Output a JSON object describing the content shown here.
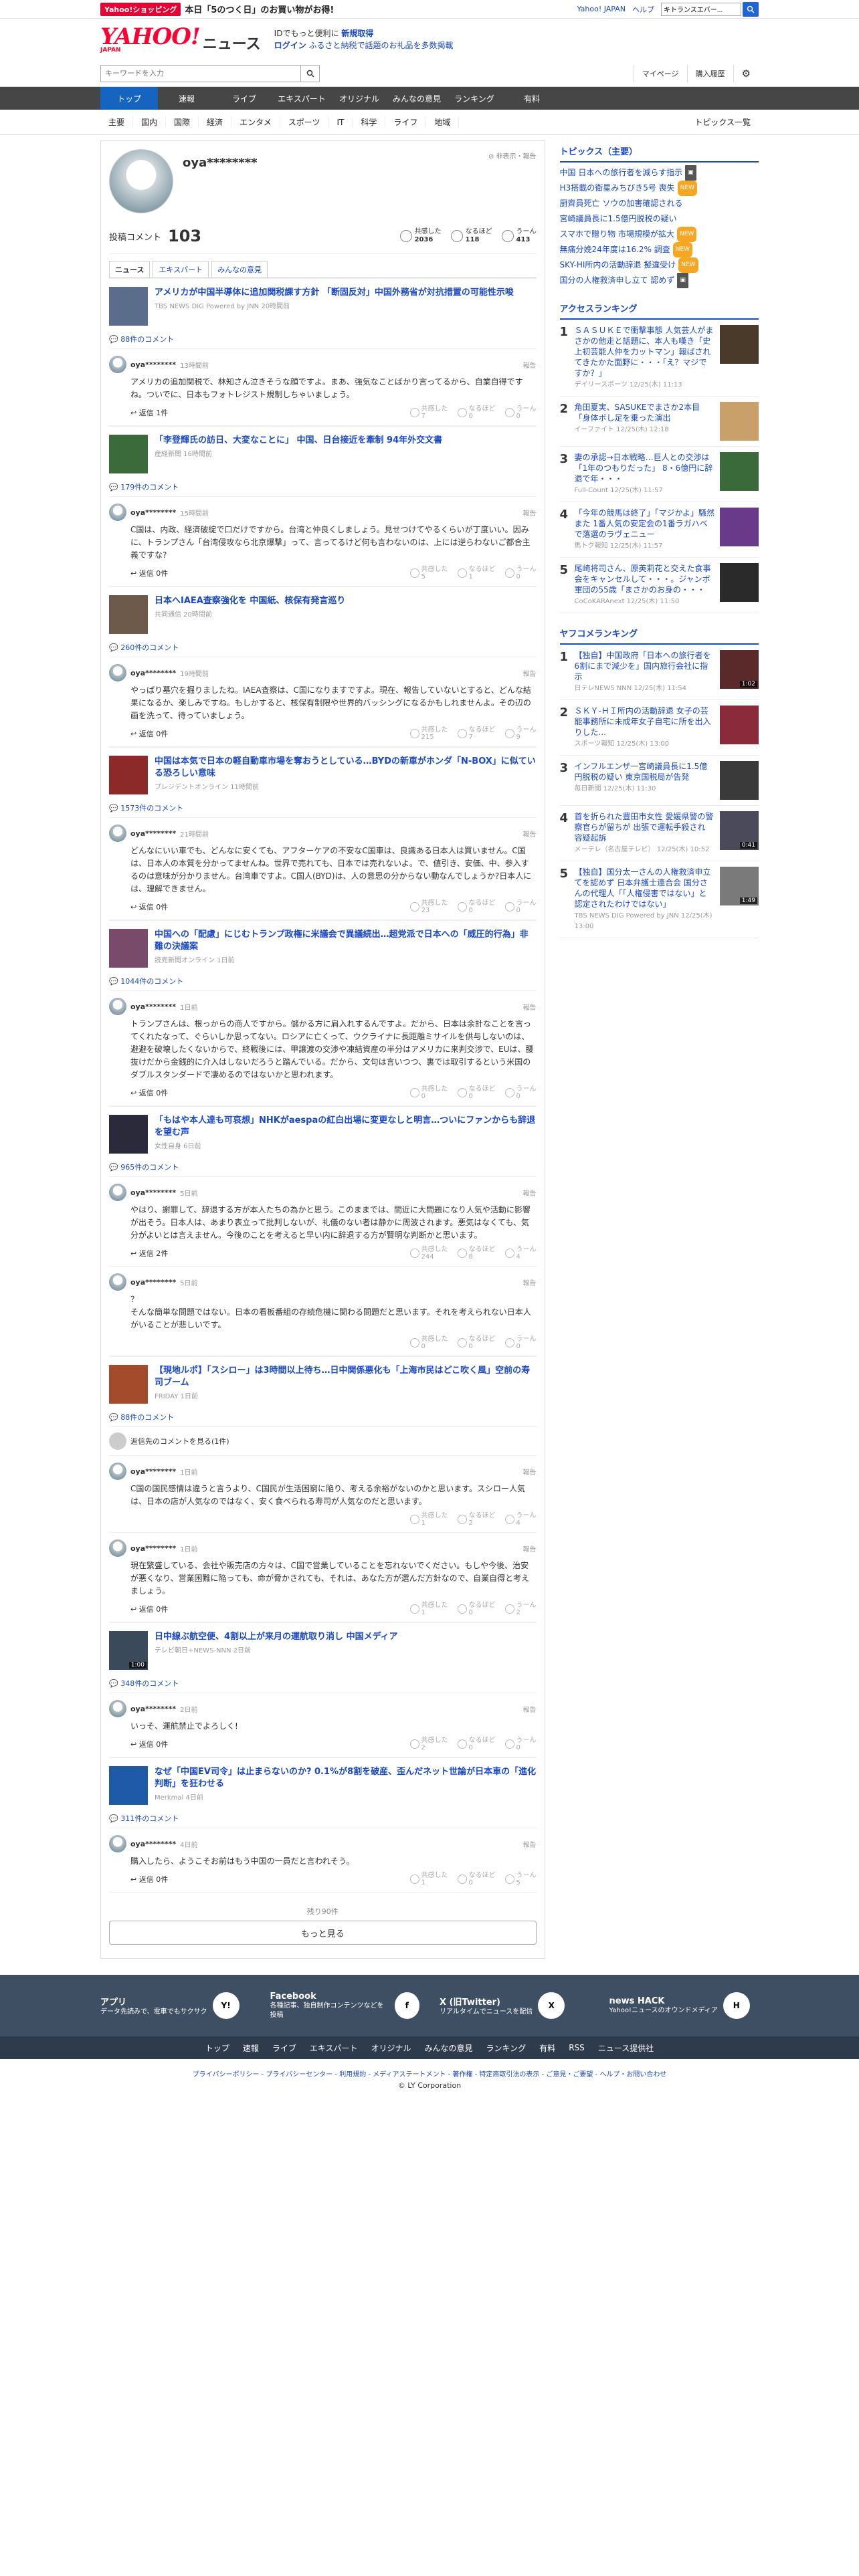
{
  "promo": {
    "tag": "Yahoo!ショッピング",
    "text": "本日「5のつく日」のお買い物がお得!",
    "links": [
      "Yahoo! JAPAN",
      "ヘルプ"
    ],
    "search_placeholder": "ウェブ検索",
    "search_value": "キトランスエバー..."
  },
  "header": {
    "logo": "YAHOO!",
    "logo_sub": "JAPAN",
    "brand": "ニュース",
    "line1": "IDでもっと便利に",
    "line1_link": "新規取得",
    "line2_link": "ログイン",
    "line2_text": "ふるさと納税で話題のお礼品を多数掲載"
  },
  "search": {
    "placeholder": "キーワードを入力",
    "mypage": "マイページ",
    "history": "購入履歴"
  },
  "gnav": [
    "トップ",
    "速報",
    "ライブ",
    "エキスパート",
    "オリジナル",
    "みんなの意見",
    "ランキング",
    "有料"
  ],
  "cnav": [
    "主要",
    "国内",
    "国際",
    "経済",
    "エンタメ",
    "スポーツ",
    "IT",
    "科学",
    "ライフ",
    "地域"
  ],
  "cnav_right": "トピックス一覧",
  "profile": {
    "name": "oya********",
    "report": "非表示・報告",
    "label": "投稿コメント",
    "count": "103",
    "reacts": [
      {
        "label": "共感した",
        "val": "2036"
      },
      {
        "label": "なるほど",
        "val": "118"
      },
      {
        "label": "うーん",
        "val": "413"
      }
    ]
  },
  "tabs": [
    "ニュース",
    "エキスパート",
    "みんなの意見"
  ],
  "reply_label": "返信",
  "empathy": "共感した",
  "naruhodo": "なるほど",
  "uun": "うーん",
  "articles": [
    {
      "title": "アメリカが中国半導体に追加関税課す方針 「断固反対」中国外務省が対抗措置の可能性示唆",
      "src": "TBS NEWS DIG Powered by JNN 20時間前",
      "count": "88件のコメント",
      "thumb": "#5a6e8c",
      "comments": [
        {
          "name": "oya********",
          "time": "13時間前",
          "report": "報告",
          "body": "アメリカの追加関税で、林知さん泣きそうな顔ですよ。まあ、強気なことばかり言ってるから、自業自得ですね。ついでに、日本もフォトレジスト規制しちゃいましょう。",
          "reply": "返信 1件",
          "r": [
            "7",
            "0",
            "0"
          ]
        }
      ]
    },
    {
      "title": "「李登輝氏の訪日、大変なことに」 中国、日台接近を牽制 94年外交文書",
      "src": "産経新聞 16時間前",
      "count": "179件のコメント",
      "thumb": "#3b6b3b",
      "comments": [
        {
          "name": "oya********",
          "time": "15時間前",
          "report": "報告",
          "body": "C国は、内政、経済破綻で口だけですから。台湾と仲良くしましょう。見せつけてやるくらいが丁度いい。因みに、トランプさん「台湾侵攻なら北京爆撃」って、言ってるけど何も言わないのは、上には逆らわないご都合主義ですな?",
          "reply": "返信 0件",
          "r": [
            "5",
            "1",
            "0"
          ]
        }
      ]
    },
    {
      "title": "日本へIAEA査察強化を 中国紙、核保有発言巡り",
      "src": "共同通信 20時間前",
      "count": "260件のコメント",
      "thumb": "#6d5a4a",
      "comments": [
        {
          "name": "oya********",
          "time": "19時間前",
          "report": "報告",
          "body": "やっぱり墓穴を掘りましたね。IAEA査察は、C国になりますですよ。現在、報告していないとすると、どんな結果になるか、楽しみですね。もしかすると、核保有制限や世界的バッシングになるかもしれませんよ。その辺の画を洗って、待っていましょう。",
          "reply": "返信 0件",
          "r": [
            "215",
            "7",
            "9"
          ]
        }
      ]
    },
    {
      "title": "中国は本気で日本の軽自動車市場を奪おうとしている…BYDの新車がホンダ「N-BOX」に似ている恐ろしい意味",
      "src": "プレジデントオンライン 11時間前",
      "count": "1573件のコメント",
      "thumb": "#8c2a2a",
      "comments": [
        {
          "name": "oya********",
          "time": "21時間前",
          "report": "報告",
          "body": "どんなにいい車でも、どんなに安くても、アフターケアの不安なC国車は、良識ある日本人は買いません。C国は、日本人の本質を分かってませんね。世界で売れても、日本では売れないよ。で、値引き、安価、中、参入するのは意味が分かりません。台湾車ですよ。C国人(BYD)は、人の意思の分からない動なんでしょうか?日本人には、理解できません。",
          "reply": "返信 0件",
          "r": [
            "23",
            "0",
            "0"
          ]
        }
      ]
    },
    {
      "title": "中国への「配慮」にじむトランプ政権に米議会で異議続出…超党派で日本への「威圧的行為」非難の決議案",
      "src": "読売新聞オンライン 1日前",
      "count": "1044件のコメント",
      "thumb": "#7a4a6b",
      "comments": [
        {
          "name": "oya********",
          "time": "1日前",
          "report": "報告",
          "body": "トランプさんは、根っからの商人ですから。儲かる方に肩入れするんですよ。だから、日本は余計なことを言ってくれたなって、ぐらいしか思ってない。ロシアに亡くって、ウクライナに長距離ミサイルを供与しないのは、避避を破壊したくないからで、終戦後には、甲譲渡の交渉や凍結資産の半分はアメリカに来判交涉で、EUは、腰抜けだから金銭的に介入はしないだろうと踏んでいる。だから、文句は言いつつ、裏では取引するという米国のダブルスタンダードで凄めるのではないかと思われます。",
          "reply": "返信 0件",
          "r": [
            "0",
            "0",
            "0"
          ]
        }
      ]
    },
    {
      "title": "「もはや本人達も可哀想」NHKがaespaの紅白出場に変更なしと明言…ついにファンからも辞退を望む声",
      "src": "女性自身 6日前",
      "count": "965件のコメント",
      "thumb": "#2a2a3a",
      "comments": [
        {
          "name": "oya********",
          "time": "5日前",
          "report": "報告",
          "body": "やはり、謝罪して、辞退する方が本人たちの為かと思う。このままでは、間近に大問題になり人気や活動に影響が出そう。日本人は、あまり表立って批判しないが、礼儀のない者は静かに周波されます。悪気はなくても、気分がよいとは言えません。今後のことを考えると早い内に辞退する方が賢明な判断かと思います。",
          "reply": "返信 2件",
          "r": [
            "244",
            "8",
            "4"
          ]
        },
        {
          "name": "oya********",
          "time": "5日前",
          "report": "報告",
          "body": "？\nそんな簡単な問題ではない。日本の看板番組の存続危機に関わる問題だと思います。それを考えられない日本人がいることが悲しいです。",
          "reply": "",
          "r": [
            "0",
            "0",
            "0"
          ]
        }
      ]
    },
    {
      "title": "【現地ルポ】「スシロー」は3時間以上待ち…日中関係悪化も「上海市民はどこ吹く風」空前の寿司ブーム",
      "src": "FRIDAY 1日前",
      "count": "88件のコメント",
      "thumb": "#a34b2a",
      "hidden": "返信先のコメントを見る(1件)",
      "comments": [
        {
          "name": "oya********",
          "time": "1日前",
          "report": "報告",
          "body": "C国の国民感情は違うと言うより、C国民が生活困窮に陥り、考える余裕がないのかと思います。スシロー人気は、日本の店が人気なのではなく、安く食べられる寿司が人気なのだと思います。",
          "reply": "",
          "r": [
            "1",
            "2",
            "4"
          ]
        },
        {
          "name": "oya********",
          "time": "1日前",
          "report": "報告",
          "body": "現在繁盛している、会社や販売店の方々は、C国で営業していることを忘れないでください。もしや今後、治安が悪くなり、営業困難に陥っても、命が脅かされても、それは、あなた方が選んだ方針なので、自業自得と考えましょう。",
          "reply": "返信 0件",
          "r": [
            "1",
            "0",
            "2"
          ]
        }
      ]
    },
    {
      "title": "日中線ぶ航空便、4割以上が来月の運航取り消し 中国メディア",
      "src": "テレビ朝日+NEWS-NNN 2日前",
      "count": "348件のコメント",
      "thumb": "#3a4a5a",
      "video": "1:00",
      "comments": [
        {
          "name": "oya********",
          "time": "2日前",
          "report": "報告",
          "body": "いっそ、運航禁止でよろしく!",
          "reply": "返信 0件",
          "r": [
            "2",
            "0",
            "0"
          ]
        }
      ]
    },
    {
      "title": "なぜ「中国EV司令」は止まらないのか? 0.1%が8割を破産、歪んだネット世論が日本車の「進化判断」を狂わせる",
      "src": "Merkmal 4日前",
      "count": "311件のコメント",
      "thumb": "#1e5aa8",
      "comments": [
        {
          "name": "oya********",
          "time": "4日前",
          "report": "報告",
          "body": "購入したら、ようこそお前はもう中国の一員だと言われそう。",
          "reply": "返信 0件",
          "r": [
            "1",
            "0",
            "5"
          ]
        }
      ]
    }
  ],
  "more_label": "残り90件",
  "more_button": "もっと見る",
  "side": {
    "topics_title": "トピックス（主要）",
    "topics": [
      {
        "t": "中国 日本への旅行者を減らす指示",
        "b": "pic"
      },
      {
        "t": "H3搭載の衛星みちびき5号 喪失",
        "b": "new"
      },
      {
        "t": "厨齊員死亡 ソウの加害確認される",
        "b": ""
      },
      {
        "t": "宮崎議員長に1.5億円脱税の疑い",
        "b": ""
      },
      {
        "t": "スマホで贈り物 市場規模が拡大",
        "b": "new"
      },
      {
        "t": "無痛分娩24年度は16.2% 調査",
        "b": "new"
      },
      {
        "t": "SKY-HI所内の活動辞退 擬違受け",
        "b": "new"
      },
      {
        "t": "国分の人権救済申し立て 認めず",
        "b": "pic"
      }
    ],
    "access_title": "アクセスランキング",
    "access": [
      {
        "t": "ＳＡＳＵＫＥで衝撃事態 人気芸人がまさかの他走と話題に、本人も嘆き「史上初芸能人仲を力ットマン」報ばされてきたかた面野に・・・「え？マジですか？」",
        "s": "デイリースポーツ 12/25(木) 11:13",
        "c": "#4a3a2a"
      },
      {
        "t": "角田夏実、SASUKEでまさか2本目「身体ボし足を乗った演出",
        "s": "イーファイト 12/25(木) 12:18",
        "c": "#caa06a"
      },
      {
        "t": "妻の承認→日本戦略…巨人との交渉は「1年のつもりだった」 8・6億円に辞退で年・・・",
        "s": "Full-Count 12/25(木) 11:57",
        "c": "#3a6a3a"
      },
      {
        "t": "「今年の競馬は終了」「マジかよ」騒然また 1番人気の安定会の1番ラガハベで落選のラヴェニュー",
        "s": "馬トク報知 12/25(木) 11:57",
        "c": "#6a3a8a"
      },
      {
        "t": "尾崎将司さん、原英莉花と交えた食事会をキャンセルして・・・。ジャンボ軍団の55歳「まさかのお身の・・・",
        "s": "CoCoKARAnext 12/25(木) 11:50",
        "c": "#2a2a2a"
      }
    ],
    "yahoo_title": "ヤフコメランキング",
    "yahoo": [
      {
        "t": "【独自】中国政府「日本への旅行者を6割にまで減少を」国内旅行会社に指示",
        "s": "日テレNEWS NNN 12/25(木) 11:54",
        "c": "#5a2a2a",
        "v": "1:02"
      },
      {
        "t": "ＳＫＹ-ＨＩ所内の活動辞退 女子の芸能事務所に未成年女子自宅に所を出入りした...",
        "s": "スポーツ報知 12/25(木) 13:00",
        "c": "#8a2a3a",
        "v": ""
      },
      {
        "t": "インフルエンザ一宮崎議員長に1.5億円脱税の疑い 東京国税局が告発",
        "s": "毎日新聞 12/25(木) 11:30",
        "c": "#3a3a3a",
        "v": ""
      },
      {
        "t": "首を折られた豊田市女性 愛媛県警の警察官らが留ちが 出張で運転手殺され 容疑起訴",
        "s": "メーテレ（名古屋テレビ） 12/25(木) 10:52",
        "c": "#4a4a5a",
        "v": "0:41"
      },
      {
        "t": "【独自】国分太一さんの人権救済申立てを認めず 日本弁護士連合会 国分さんの代理人「「人権侵害ではない」と認定されたわけではない」",
        "s": "TBS NEWS DIG Powered by JNN 12/25(木) 13:00",
        "c": "#7a7a7a",
        "v": "1:49"
      }
    ]
  },
  "footer": {
    "items": [
      {
        "title": "アプリ",
        "desc": "データ先読みで、電車でもサクサク",
        "icon": "Y!"
      },
      {
        "title": "Facebook",
        "desc": "各種記事、独自制作コンテンツなどを投稿",
        "icon": "f"
      },
      {
        "title": "X (旧Twitter)",
        "desc": "リアルタイムでニュースを配信",
        "icon": "X"
      },
      {
        "title": "news HACK",
        "desc": "Yahoo!ニュースのオウンドメディア",
        "icon": "H"
      }
    ],
    "nav": [
      "トップ",
      "速報",
      "ライブ",
      "エキスパート",
      "オリジナル",
      "みんなの意見",
      "ランキング",
      "有料",
      "RSS",
      "ニュース提供社"
    ],
    "links": "プライバシーポリシー - プライバシーセンター - 利用規約 - メディアステートメント - 著作権 - 特定商取引法の表示 - ご意見・ご要望 - ヘルプ・お問い合わせ",
    "copy": "© LY Corporation"
  }
}
